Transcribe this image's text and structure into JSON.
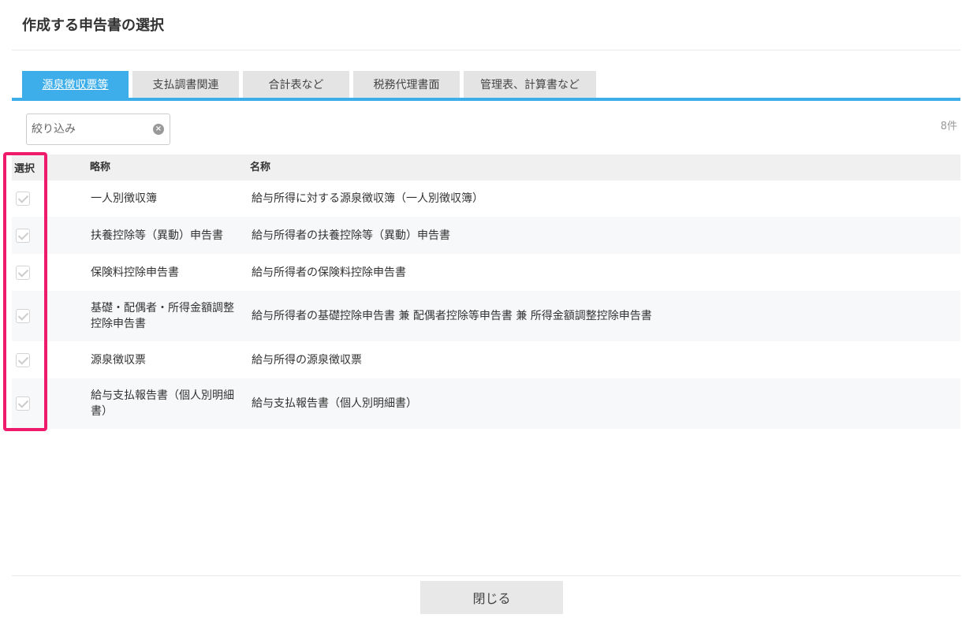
{
  "dialog": {
    "title": "作成する申告書の選択",
    "close_label": "閉じる"
  },
  "tabs": [
    {
      "label": "源泉徴収票等",
      "active": true
    },
    {
      "label": "支払調書関連",
      "active": false
    },
    {
      "label": "合計表など",
      "active": false
    },
    {
      "label": "税務代理書面",
      "active": false
    },
    {
      "label": "管理表、計算書など",
      "active": false
    }
  ],
  "filter": {
    "placeholder": "絞り込み",
    "value": "",
    "clear_icon": "clear-circle-icon"
  },
  "count_label": "8件",
  "table": {
    "headers": {
      "select": "選択",
      "abbr": "略称",
      "name": "名称"
    },
    "rows": [
      {
        "abbr": "一人別徴収簿",
        "name": "給与所得に対する源泉徴収簿（一人別徴収簿）",
        "checked": true
      },
      {
        "abbr": "扶養控除等（異動）申告書",
        "name": "給与所得者の扶養控除等（異動）申告書",
        "checked": true
      },
      {
        "abbr": "保険料控除申告書",
        "name": "給与所得者の保険料控除申告書",
        "checked": true
      },
      {
        "abbr": "基礎・配偶者・所得金額調整控除申告書",
        "name": "給与所得者の基礎控除申告書 兼 配偶者控除等申告書 兼 所得金額調整控除申告書",
        "checked": true
      },
      {
        "abbr": "源泉徴収票",
        "name": "給与所得の源泉徴収票",
        "checked": true
      },
      {
        "abbr": "給与支払報告書（個人別明細書）",
        "name": "給与支払報告書（個人別明細書）",
        "checked": true
      }
    ]
  },
  "colors": {
    "accent": "#3daee9",
    "highlight": "#ee1b6c"
  }
}
